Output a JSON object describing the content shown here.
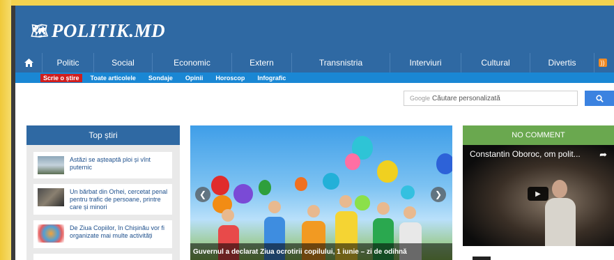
{
  "site": {
    "logo_text": "POLITIK.MD",
    "logo_icon": "world-map-icon"
  },
  "nav": {
    "home_icon": "home-icon",
    "items": [
      "Politic",
      "Social",
      "Economic",
      "Extern",
      "Transnistria",
      "Interviuri",
      "Cultural",
      "Divertis"
    ],
    "rss_icon": "rss-icon"
  },
  "subnav": {
    "items": [
      "Scrie o știre",
      "Toate articolele",
      "Sondaje",
      "Opinii",
      "Horoscop",
      "Infografic"
    ]
  },
  "search": {
    "brand": "Google",
    "placeholder": "Căutare personalizată",
    "button_icon": "search-icon"
  },
  "top_news": {
    "title": "Top știri",
    "items": [
      "Astăzi se așteaptă ploi și vînt puternic",
      "Un bărbat din Orhei, cercetat penal pentru trafic de persoane, printre care și minori",
      "De Ziua Copiilor, în Chișinău vor fi organizate mai multe activități"
    ]
  },
  "slider": {
    "caption": "Guvernul a declarat Ziua ocrotirii copilului, 1 iunie – zi de odihnă"
  },
  "no_comment": {
    "title": "NO COMMENT",
    "video_title": "Constantin Oboroc, om polit..."
  },
  "colors": {
    "brand_blue": "#2f69a3",
    "subnav_blue": "#1a87d4",
    "highlight_red": "#d01f1f",
    "green": "#6aa84f",
    "search_button": "#3b82e0"
  }
}
